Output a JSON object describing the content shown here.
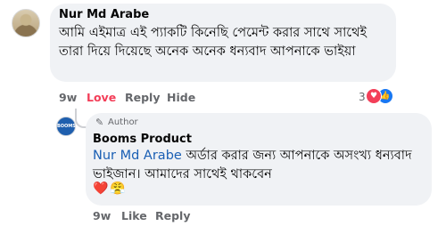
{
  "comment": {
    "author": "Nur Md Arabe",
    "text": "আমি এইমাত্র এই প্যাকটি কিনেছি পেমেন্ট করার সাথে সাথেই তারা দিয়ে দিয়েছে অনেক অনেক ধন্যবাদ আপনাকে ভাইয়া",
    "time": "9w",
    "love_label": "Love",
    "reply_label": "Reply",
    "hide_label": "Hide",
    "reaction_count": "3"
  },
  "reply": {
    "author_badge": "Author",
    "author": "Booms Product",
    "mention": "Nur Md Arabe",
    "text": "অর্ডার করার জন্য আপনাকে অসংখ্য ধন্যবাদ ভাইজান। আমাদের সাথেই থাকবেন",
    "emojis": "❤️😤",
    "time": "9w",
    "like_label": "Like",
    "reply_label": "Reply"
  },
  "icons": {
    "author_badge_icon": "pen-icon",
    "reaction_1": "heart-icon",
    "reaction_2": "like-icon"
  },
  "colors": {
    "love": "#f33e58",
    "like": "#1877f2",
    "mention": "#1a5fb4",
    "bubble": "#f0f2f5"
  }
}
